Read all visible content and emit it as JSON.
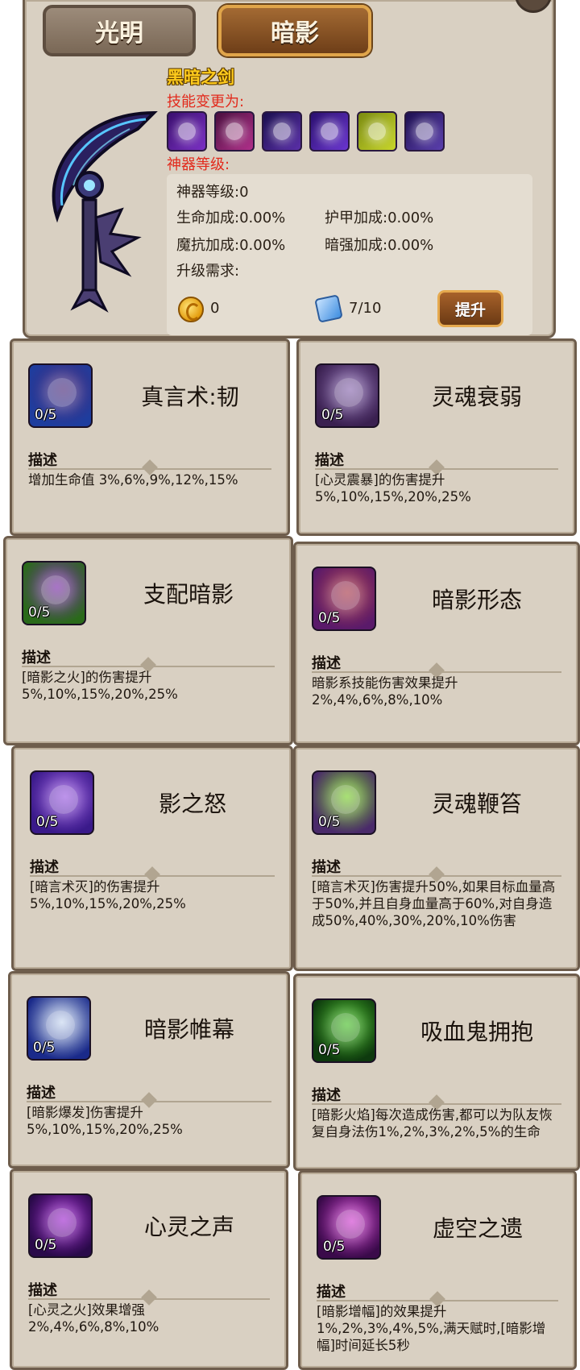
{
  "tabs": {
    "light": "光明",
    "shadow": "暗影"
  },
  "artifact": {
    "name": "黑暗之剑",
    "skills_change_label": "技能变更为:",
    "level_label": "神器等级:",
    "skill_icon_colors": [
      "#7a2fc4",
      "#b02f8a",
      "#5a2fa8",
      "#6a35d0",
      "#c8d62a",
      "#5b3fae"
    ]
  },
  "stats": {
    "artifact_level": "神器等级:0",
    "hp_bonus": "生命加成:0.00%",
    "armor_bonus": "护甲加成:0.00%",
    "magic_res_bonus": "魔抗加成:0.00%",
    "dark_power_bonus": "暗强加成:0.00%",
    "upgrade_requirement_label": "升级需求:",
    "gold_amount": "0",
    "crystal_amount": "7/10",
    "upgrade_button": "提升"
  },
  "skills": [
    {
      "name": "真言术:韧",
      "level": "0/5",
      "desc_label": "描述",
      "desc": "增加生命值 3%,6%,9%,12%,15%",
      "icon_colors": [
        "#1e3d9e",
        "#4a2a7a"
      ]
    },
    {
      "name": "灵魂衰弱",
      "level": "0/5",
      "desc_label": "描述",
      "desc": "[心灵震暴]的伤害提升5%,10%,15%,20%,25%",
      "icon_colors": [
        "#3a2050",
        "#8a6ab0"
      ]
    },
    {
      "name": "支配暗影",
      "level": "0/5",
      "desc_label": "描述",
      "desc": "[暗影之火]的伤害提升5%,10%,15%,20%,25%",
      "icon_colors": [
        "#2a6a1a",
        "#7a2aa8"
      ]
    },
    {
      "name": "暗影形态",
      "level": "0/5",
      "desc_label": "描述",
      "desc": "暗影系技能伤害效果提升 2%,4%,6%,8%,10%",
      "icon_colors": [
        "#5a1a6a",
        "#a83a4a"
      ]
    },
    {
      "name": "影之怒",
      "level": "0/5",
      "desc_label": "描述",
      "desc": "[暗言术灭]的伤害提升5%,10%,15%,20%,25%",
      "icon_colors": [
        "#3a1a8a",
        "#9a5ae0"
      ]
    },
    {
      "name": "灵魂鞭笞",
      "level": "0/5",
      "desc_label": "描述",
      "desc": "[暗言术灭]伤害提升50%,如果目标血量高于50%,并且自身血量高于60%,对自身造成50%,40%,30%,20%,10%伤害",
      "icon_colors": [
        "#4a2a6a",
        "#7ad02a"
      ]
    },
    {
      "name": "暗影帷幕",
      "level": "0/5",
      "desc_label": "描述",
      "desc": "[暗影爆发]伤害提升5%,10%,15%,20%,25%",
      "icon_colors": [
        "#1a2a8a",
        "#c8d8f0"
      ]
    },
    {
      "name": "吸血鬼拥抱",
      "level": "0/5",
      "desc_label": "描述",
      "desc": "[暗影火焰]每次造成伤害,都可以为队友恢复自身法伤1%,2%,3%,2%,5%的生命",
      "icon_colors": [
        "#0e3a0e",
        "#4ac02a"
      ]
    },
    {
      "name": "心灵之声",
      "level": "0/5",
      "desc_label": "描述",
      "desc": "[心灵之火]效果增强2%,4%,6%,8%,10%",
      "icon_colors": [
        "#2a0a4a",
        "#a02ad0"
      ]
    },
    {
      "name": "虚空之遗",
      "level": "0/5",
      "desc_label": "描述",
      "desc": "[暗影增幅]的效果提升1%,2%,3%,4%,5%,满天赋时,[暗影增幅]时间延长5秒",
      "icon_colors": [
        "#3a0a4a",
        "#d040d0"
      ]
    }
  ]
}
